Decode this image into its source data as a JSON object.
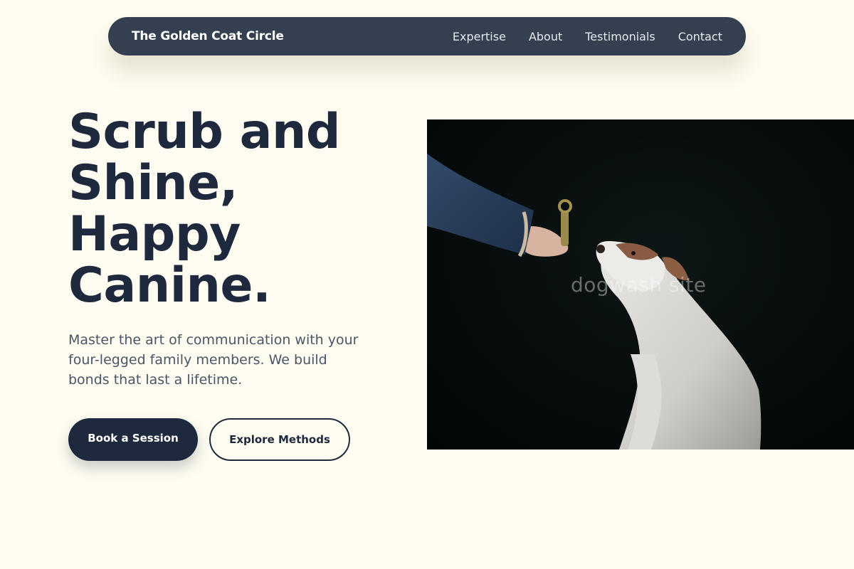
{
  "nav": {
    "brand": "The Golden Coat Circle",
    "links": [
      "Expertise",
      "About",
      "Testimonials",
      "Contact"
    ]
  },
  "hero": {
    "headline_lines": [
      "Scrub and",
      "Shine,",
      "Happy",
      "Canine."
    ],
    "lede_lines": [
      "Master the art of communication with your",
      "four-legged family members. We build",
      "bonds that last a lifetime."
    ],
    "primary_cta": "Book a Session",
    "secondary_cta": "Explore Methods",
    "image_watermark": "dogwash site"
  },
  "colors": {
    "background": "#fefcf0",
    "nav_background": "#344050",
    "heading": "#1e293d",
    "body_text": "#4a5566"
  }
}
